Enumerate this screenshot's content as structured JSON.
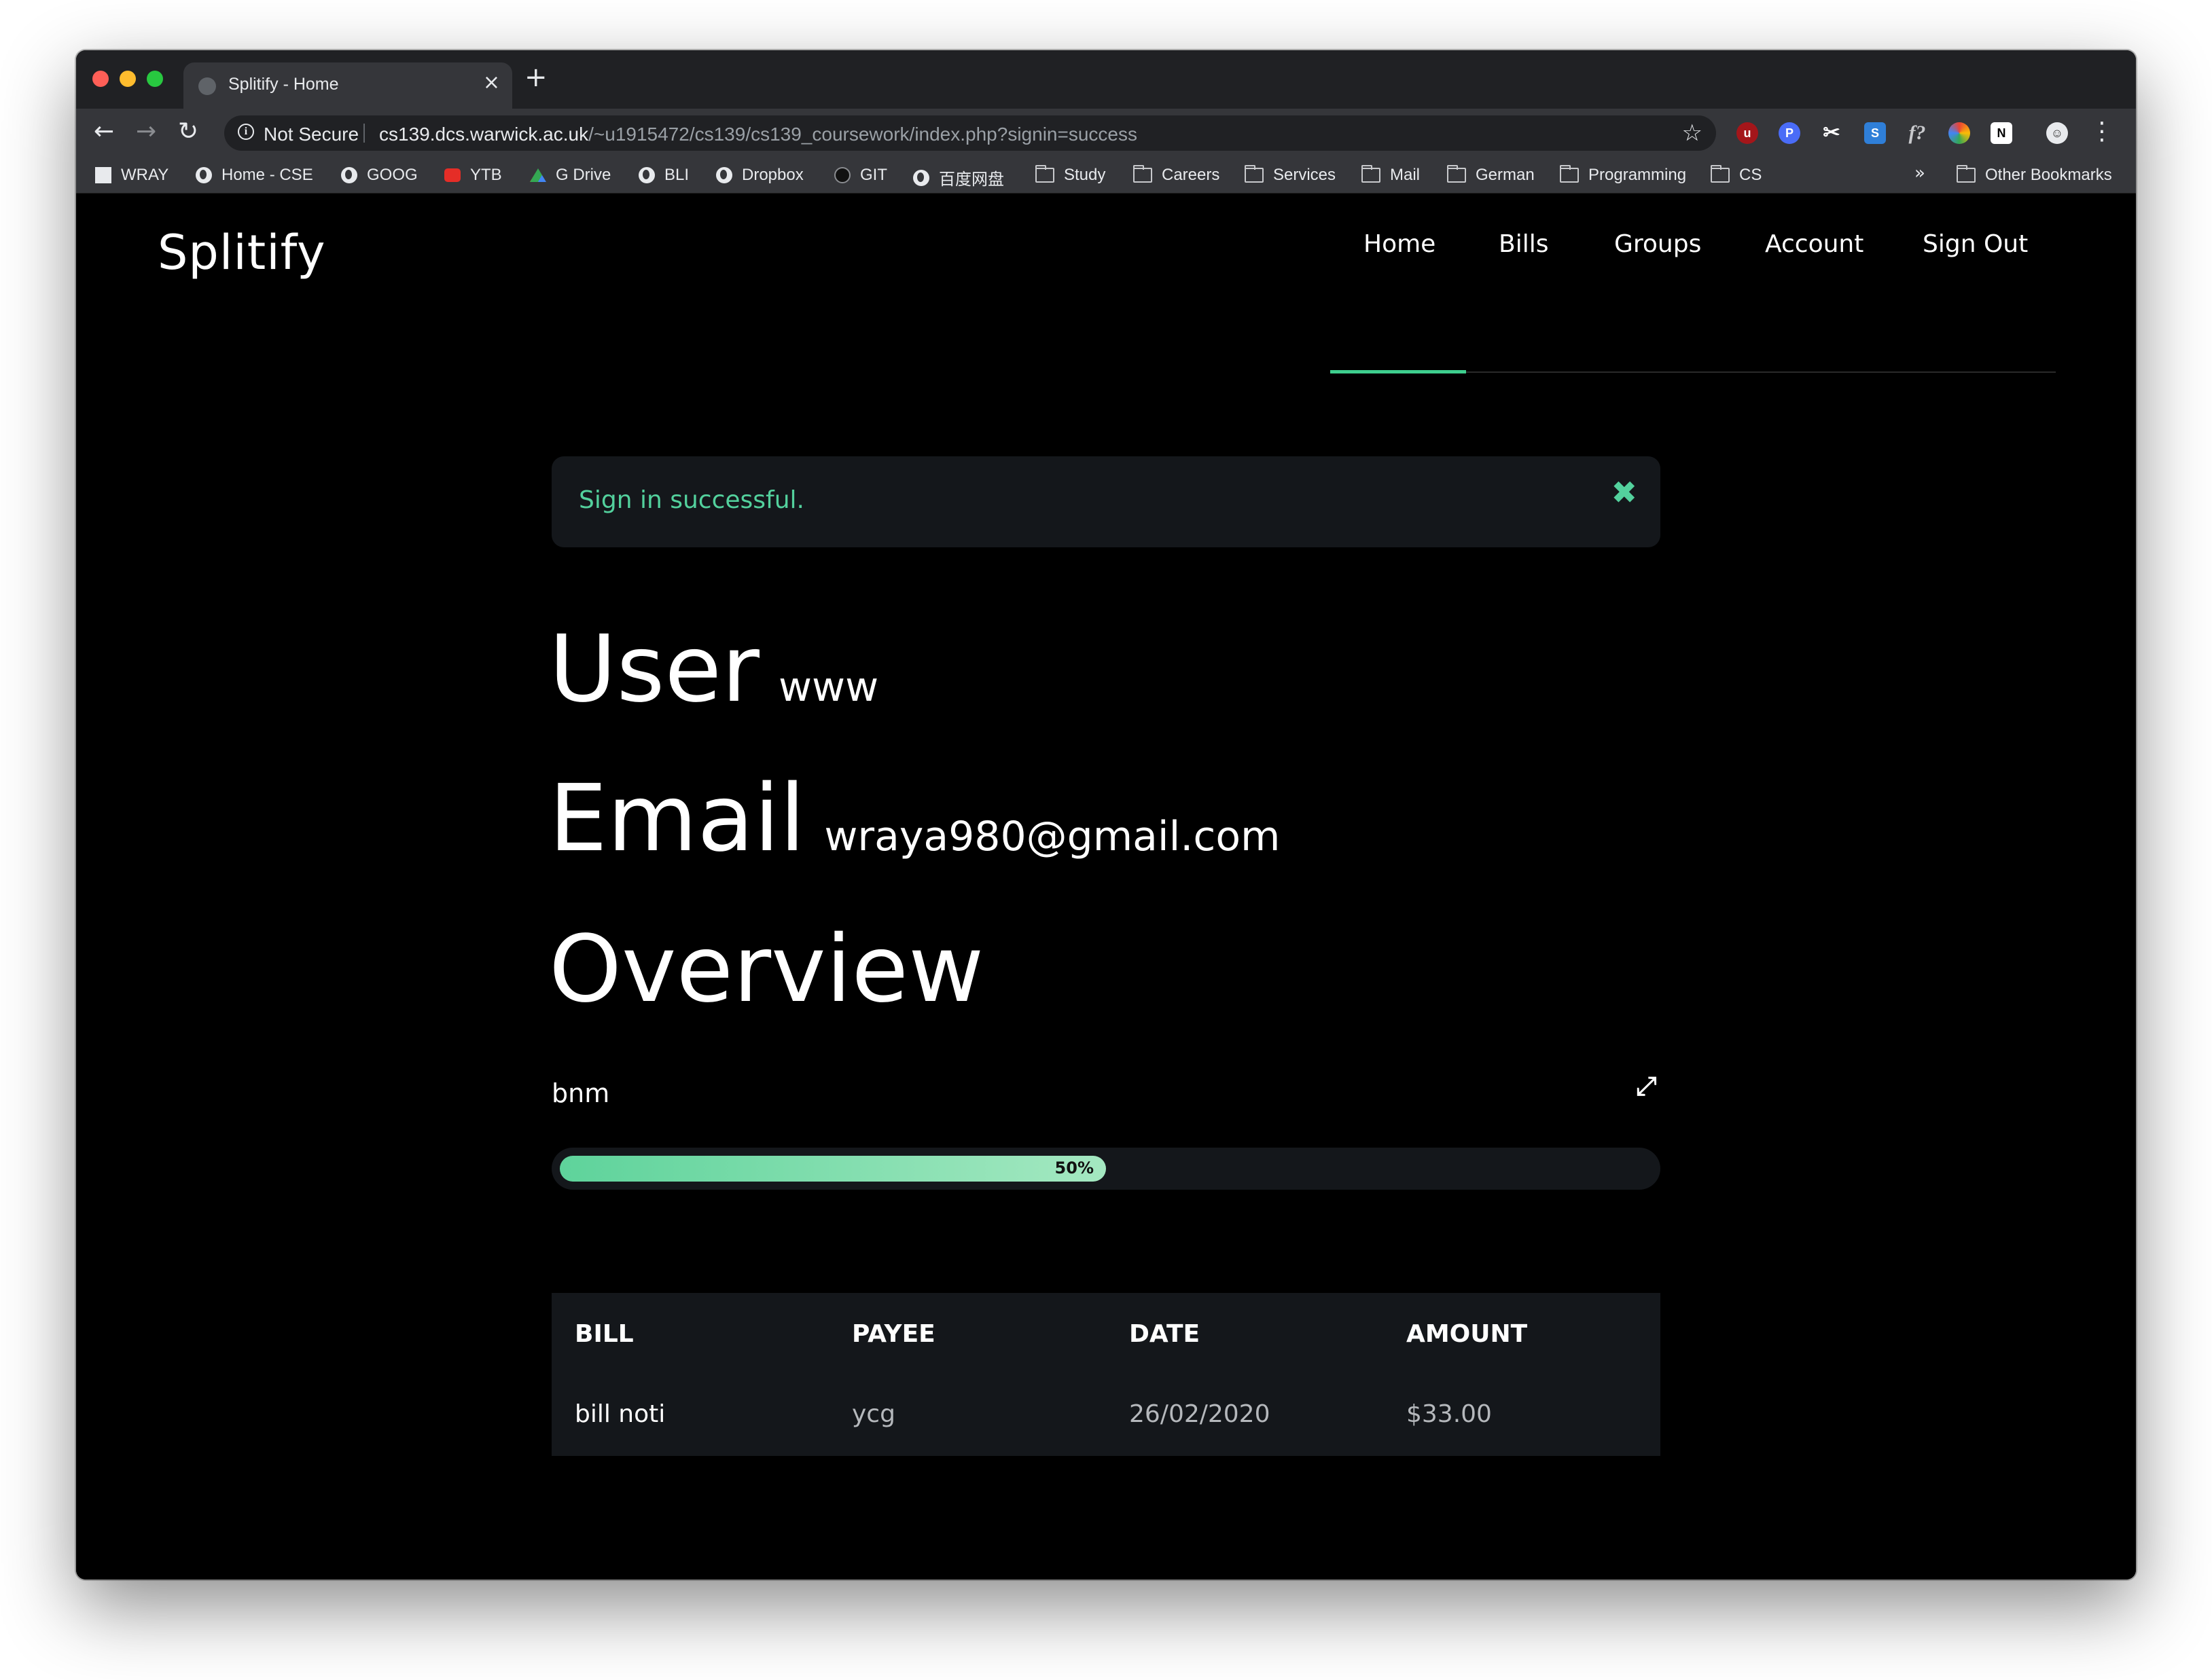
{
  "browser": {
    "tab_title": "Splitify - Home",
    "tab_close": "×",
    "new_tab": "+",
    "security_label": "Not Secure",
    "url_host": "cs139.dcs.warwick.ac.uk",
    "url_path": "/~u1915472/cs139/cs139_coursework/index.php?signin=success",
    "bookmarks": [
      {
        "label": "WRAY",
        "icon": "avatar-icon"
      },
      {
        "label": "Home - CSE",
        "icon": "globe-icon"
      },
      {
        "label": "GOOG",
        "icon": "globe-icon"
      },
      {
        "label": "YTB",
        "icon": "youtube-icon"
      },
      {
        "label": "G Drive",
        "icon": "drive-icon"
      },
      {
        "label": "BLI",
        "icon": "globe-icon"
      },
      {
        "label": "Dropbox",
        "icon": "globe-icon"
      },
      {
        "label": "GIT",
        "icon": "github-icon"
      },
      {
        "label": "百度网盘",
        "icon": "globe-icon"
      },
      {
        "label": "Study",
        "icon": "folder-icon"
      },
      {
        "label": "Careers",
        "icon": "folder-icon"
      },
      {
        "label": "Services",
        "icon": "folder-icon"
      },
      {
        "label": "Mail",
        "icon": "folder-icon"
      },
      {
        "label": "German",
        "icon": "folder-icon"
      },
      {
        "label": "Programming",
        "icon": "folder-icon"
      },
      {
        "label": "CS",
        "icon": "folder-icon"
      }
    ],
    "bookmarks_overflow": "»",
    "other_bookmarks": "Other Bookmarks"
  },
  "site": {
    "brand": "Splitify",
    "nav": [
      "Home",
      "Bills",
      "Groups",
      "Account",
      "Sign Out"
    ],
    "active_nav": "Home",
    "accent_color": "#3ecf8e"
  },
  "alert": {
    "message": "Sign in successful.",
    "close": "✖"
  },
  "profile": {
    "user_label": "User",
    "user_value": "www",
    "email_label": "Email",
    "email_value": "wraya980@gmail.com",
    "overview_label": "Overview"
  },
  "progress": {
    "name": "bnm",
    "percent_text": "50%",
    "percent": 50,
    "expand_icon": "expand-icon"
  },
  "bills_table": {
    "headers": [
      "BILL",
      "PAYEE",
      "DATE",
      "AMOUNT"
    ],
    "rows": [
      [
        "bill noti",
        "ycg",
        "26/02/2020",
        "$33.00"
      ]
    ]
  }
}
